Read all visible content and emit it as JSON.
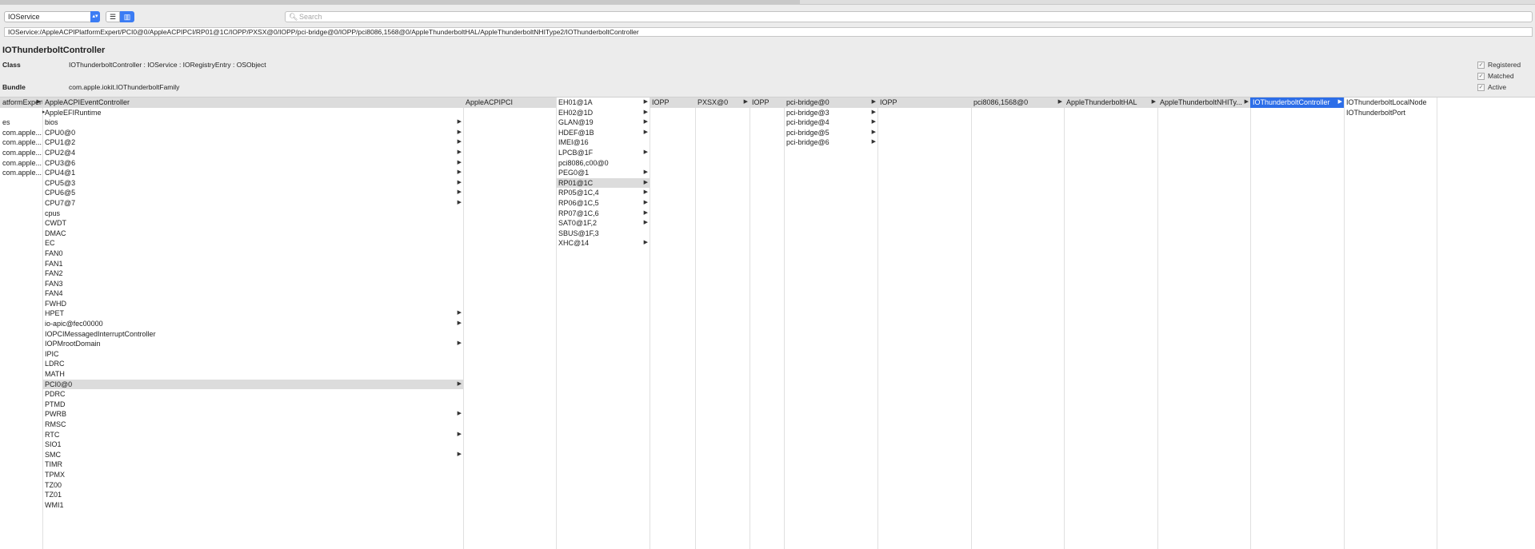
{
  "toolbar": {
    "service_select": "IOService",
    "list_view_icon": "list-icon",
    "column_view_icon": "columns-icon",
    "search_placeholder": "Search"
  },
  "path": "IOService:/AppleACPIPlatformExpert/PCI0@0/AppleACPIPCI/RP01@1C/IOPP/PXSX@0/IOPP/pci-bridge@0/IOPP/pci8086,1568@0/AppleThunderboltHAL/AppleThunderboltNHIType2/IOThunderboltController",
  "info": {
    "title": "IOThunderboltController",
    "class_label": "Class",
    "class_value": "IOThunderboltController : IOService : IORegistryEntry : OSObject",
    "bundle_label": "Bundle",
    "bundle_value": "com.apple.iokit.IOThunderboltFamily",
    "flags": [
      {
        "label": "Registered",
        "checked": true
      },
      {
        "label": "Matched",
        "checked": true
      },
      {
        "label": "Active",
        "checked": true
      }
    ]
  },
  "colors": {
    "accent": "#2d6ee8",
    "selection_gray": "#dcdcdc"
  },
  "columns": [
    {
      "rows": [
        {
          "text": "atformExpert",
          "state": "sel",
          "arrow": true
        },
        {
          "text": ""
        },
        {
          "text": "es"
        },
        {
          "text": "com.apple..."
        },
        {
          "text": "com.apple..."
        },
        {
          "text": "com.apple..."
        },
        {
          "text": "com.apple..."
        },
        {
          "text": "com.apple..."
        }
      ]
    },
    {
      "rows": [
        {
          "text": "AppleACPIEventController",
          "state": "sel"
        },
        {
          "text": "AppleEFIRuntime",
          "pre": true
        },
        {
          "text": "bios",
          "arrow": true
        },
        {
          "text": "CPU0@0",
          "arrow": true
        },
        {
          "text": "CPU1@2",
          "arrow": true
        },
        {
          "text": "CPU2@4",
          "arrow": true
        },
        {
          "text": "CPU3@6",
          "arrow": true
        },
        {
          "text": "CPU4@1",
          "arrow": true
        },
        {
          "text": "CPU5@3",
          "arrow": true
        },
        {
          "text": "CPU6@5",
          "arrow": true
        },
        {
          "text": "CPU7@7",
          "arrow": true
        },
        {
          "text": "cpus"
        },
        {
          "text": "CWDT"
        },
        {
          "text": "DMAC"
        },
        {
          "text": "EC"
        },
        {
          "text": "FAN0"
        },
        {
          "text": "FAN1"
        },
        {
          "text": "FAN2"
        },
        {
          "text": "FAN3"
        },
        {
          "text": "FAN4"
        },
        {
          "text": "FWHD"
        },
        {
          "text": "HPET",
          "arrow": true
        },
        {
          "text": "io-apic@fec00000",
          "arrow": true
        },
        {
          "text": "IOPCIMessagedInterruptController"
        },
        {
          "text": "IOPMrootDomain",
          "arrow": true
        },
        {
          "text": "IPIC"
        },
        {
          "text": "LDRC"
        },
        {
          "text": "MATH"
        },
        {
          "text": "PCI0@0",
          "state": "sel",
          "arrow": true
        },
        {
          "text": "PDRC"
        },
        {
          "text": "PTMD"
        },
        {
          "text": "PWRB",
          "arrow": true
        },
        {
          "text": "RMSC"
        },
        {
          "text": "RTC",
          "arrow": true
        },
        {
          "text": "SIO1"
        },
        {
          "text": "SMC",
          "arrow": true
        },
        {
          "text": "TIMR"
        },
        {
          "text": "TPMX"
        },
        {
          "text": "TZ00"
        },
        {
          "text": "TZ01"
        },
        {
          "text": "WMI1"
        }
      ]
    },
    {
      "rows": [
        {
          "text": "AppleACPIPCI",
          "state": "sel"
        }
      ]
    },
    {
      "rows": [
        {
          "text": "EH01@1A",
          "arrow": true
        },
        {
          "text": "EH02@1D",
          "arrow": true
        },
        {
          "text": "GLAN@19",
          "arrow": true
        },
        {
          "text": "HDEF@1B",
          "arrow": true
        },
        {
          "text": "IMEI@16"
        },
        {
          "text": "LPCB@1F",
          "arrow": true
        },
        {
          "text": "pci8086,c00@0"
        },
        {
          "text": "PEG0@1",
          "arrow": true
        },
        {
          "text": "RP01@1C",
          "state": "sel",
          "arrow": true
        },
        {
          "text": "RP05@1C,4",
          "arrow": true
        },
        {
          "text": "RP06@1C,5",
          "arrow": true
        },
        {
          "text": "RP07@1C,6",
          "arrow": true
        },
        {
          "text": "SAT0@1F,2",
          "arrow": true
        },
        {
          "text": "SBUS@1F,3"
        },
        {
          "text": "XHC@14",
          "arrow": true
        }
      ]
    },
    {
      "rows": [
        {
          "text": "IOPP",
          "state": "sel"
        }
      ]
    },
    {
      "rows": [
        {
          "text": "PXSX@0",
          "state": "sel",
          "arrow": true
        }
      ]
    },
    {
      "rows": [
        {
          "text": "IOPP",
          "state": "sel"
        }
      ]
    },
    {
      "rows": [
        {
          "text": "pci-bridge@0",
          "state": "sel",
          "arrow": true
        },
        {
          "text": "pci-bridge@3",
          "arrow": true
        },
        {
          "text": "pci-bridge@4",
          "arrow": true
        },
        {
          "text": "pci-bridge@5",
          "arrow": true
        },
        {
          "text": "pci-bridge@6",
          "arrow": true
        }
      ]
    },
    {
      "rows": [
        {
          "text": "IOPP",
          "state": "sel"
        }
      ]
    },
    {
      "rows": [
        {
          "text": "pci8086,1568@0",
          "state": "sel",
          "arrow": true
        }
      ]
    },
    {
      "rows": [
        {
          "text": "AppleThunderboltHAL",
          "state": "sel",
          "arrow": true
        }
      ]
    },
    {
      "rows": [
        {
          "text": "AppleThunderboltNHITy...",
          "state": "sel",
          "arrow": true
        }
      ]
    },
    {
      "rows": [
        {
          "text": "IOThunderboltController",
          "state": "hl",
          "arrow": true
        }
      ]
    },
    {
      "rows": [
        {
          "text": "IOThunderboltLocalNode"
        },
        {
          "text": "IOThunderboltPort"
        }
      ]
    },
    {
      "rows": []
    }
  ]
}
